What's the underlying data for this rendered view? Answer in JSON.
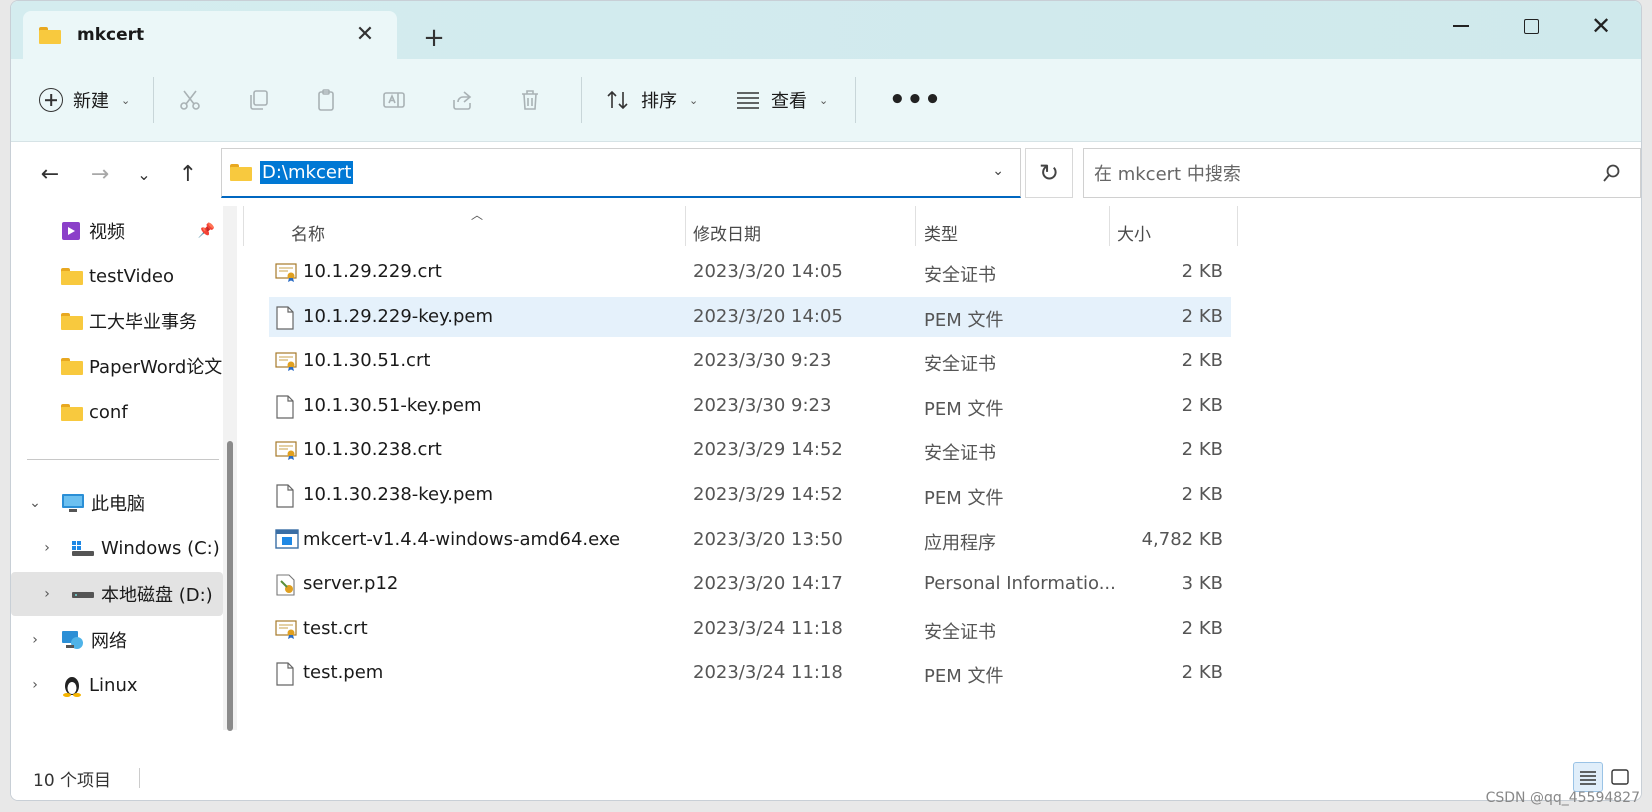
{
  "window": {
    "tab_title": "mkcert",
    "controls": [
      "minimize",
      "maximize",
      "close"
    ]
  },
  "toolbar": {
    "new_label": "新建",
    "sort_label": "排序",
    "view_label": "查看",
    "more_label": "•••"
  },
  "address": {
    "path": "D:\\mkcert",
    "search_placeholder": "在 mkcert 中搜索"
  },
  "sidebar": {
    "quick_access": [
      {
        "label": "视频",
        "icon": "video-icon",
        "pinned": true
      },
      {
        "label": "testVideo",
        "icon": "folder-icon"
      },
      {
        "label": "工大毕业事务",
        "icon": "folder-icon"
      },
      {
        "label": "PaperWord论文",
        "icon": "folder-icon"
      },
      {
        "label": "conf",
        "icon": "folder-icon"
      }
    ],
    "tree": [
      {
        "label": "此电脑",
        "icon": "pc-icon",
        "expanded": true
      },
      {
        "label": "Windows (C:)",
        "icon": "drive-icon"
      },
      {
        "label": "本地磁盘 (D:)",
        "icon": "drive-icon",
        "selected": true
      },
      {
        "label": "网络",
        "icon": "network-icon"
      },
      {
        "label": "Linux",
        "icon": "linux-icon"
      }
    ]
  },
  "columns": {
    "name": "名称",
    "date": "修改日期",
    "type": "类型",
    "size": "大小"
  },
  "files": [
    {
      "name": "10.1.29.229.crt",
      "date": "2023/3/20 14:05",
      "type": "安全证书",
      "size": "2 KB",
      "icon": "certificate-icon"
    },
    {
      "name": "10.1.29.229-key.pem",
      "date": "2023/3/20 14:05",
      "type": "PEM 文件",
      "size": "2 KB",
      "icon": "file-icon",
      "selected": true
    },
    {
      "name": "10.1.30.51.crt",
      "date": "2023/3/30 9:23",
      "type": "安全证书",
      "size": "2 KB",
      "icon": "certificate-icon"
    },
    {
      "name": "10.1.30.51-key.pem",
      "date": "2023/3/30 9:23",
      "type": "PEM 文件",
      "size": "2 KB",
      "icon": "file-icon"
    },
    {
      "name": "10.1.30.238.crt",
      "date": "2023/3/29 14:52",
      "type": "安全证书",
      "size": "2 KB",
      "icon": "certificate-icon"
    },
    {
      "name": "10.1.30.238-key.pem",
      "date": "2023/3/29 14:52",
      "type": "PEM 文件",
      "size": "2 KB",
      "icon": "file-icon"
    },
    {
      "name": "mkcert-v1.4.4-windows-amd64.exe",
      "date": "2023/3/20 13:50",
      "type": "应用程序",
      "size": "4,782 KB",
      "icon": "exe-icon"
    },
    {
      "name": "server.p12",
      "date": "2023/3/20 14:17",
      "type": "Personal Informatio...",
      "size": "3 KB",
      "icon": "p12-icon"
    },
    {
      "name": "test.crt",
      "date": "2023/3/24 11:18",
      "type": "安全证书",
      "size": "2 KB",
      "icon": "certificate-icon"
    },
    {
      "name": "test.pem",
      "date": "2023/3/24 11:18",
      "type": "PEM 文件",
      "size": "2 KB",
      "icon": "file-icon"
    }
  ],
  "status": {
    "count_text": "10 个项目"
  },
  "watermark": "CSDN @qq_45594827",
  "colors": {
    "accent": "#0078d4",
    "titlebar": "#d4ecef",
    "selection": "#e5f1fb"
  }
}
